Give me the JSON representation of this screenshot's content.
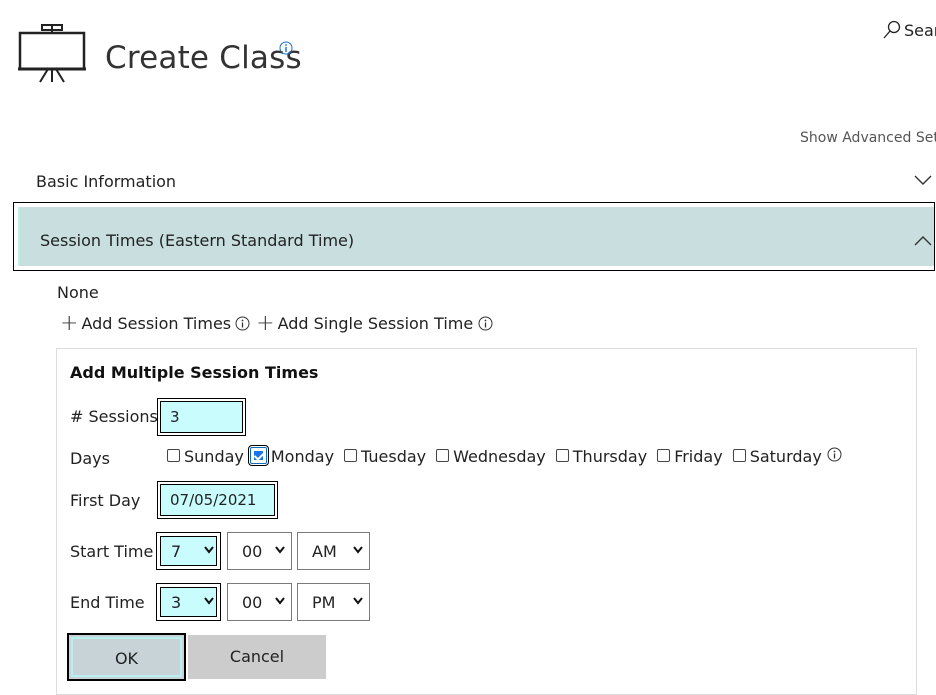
{
  "header": {
    "title": "Create Class",
    "search_label": "Sear",
    "advanced_label": "Show Advanced Settir"
  },
  "sections": {
    "basic_label": "Basic Information",
    "session_label": "Session Times (Eastern Standard Time)"
  },
  "session": {
    "empty_text": "None",
    "add_session_label": "Add Session Times",
    "add_single_label": "Add Single Session Time"
  },
  "panel": {
    "title": "Add Multiple Session Times",
    "sessions_label": "# Sessions",
    "sessions_value": "3",
    "days_label": "Days",
    "days": [
      {
        "label": "Sunday",
        "checked": false
      },
      {
        "label": "Monday",
        "checked": true
      },
      {
        "label": "Tuesday",
        "checked": false
      },
      {
        "label": "Wednesday",
        "checked": false
      },
      {
        "label": "Thursday",
        "checked": false
      },
      {
        "label": "Friday",
        "checked": false
      },
      {
        "label": "Saturday",
        "checked": false
      }
    ],
    "first_day_label": "First Day",
    "first_day_value": "07/05/2021",
    "start_label": "Start Time",
    "start_hour": "7",
    "start_minute": "00",
    "start_ampm": "AM",
    "end_label": "End Time",
    "end_hour": "3",
    "end_minute": "00",
    "end_ampm": "PM",
    "ok_label": "OK",
    "cancel_label": "Cancel"
  },
  "colors": {
    "accent_bg": "#c8fcfd",
    "section_bg": "#c9dedf",
    "check_blue": "#1a73e8"
  },
  "icons": [
    "presentation-board-icon",
    "info-icon",
    "search-icon",
    "chevron-down-icon",
    "chevron-up-icon",
    "plus-icon",
    "dropdown-arrow-icon",
    "checkbox-check-icon"
  ]
}
